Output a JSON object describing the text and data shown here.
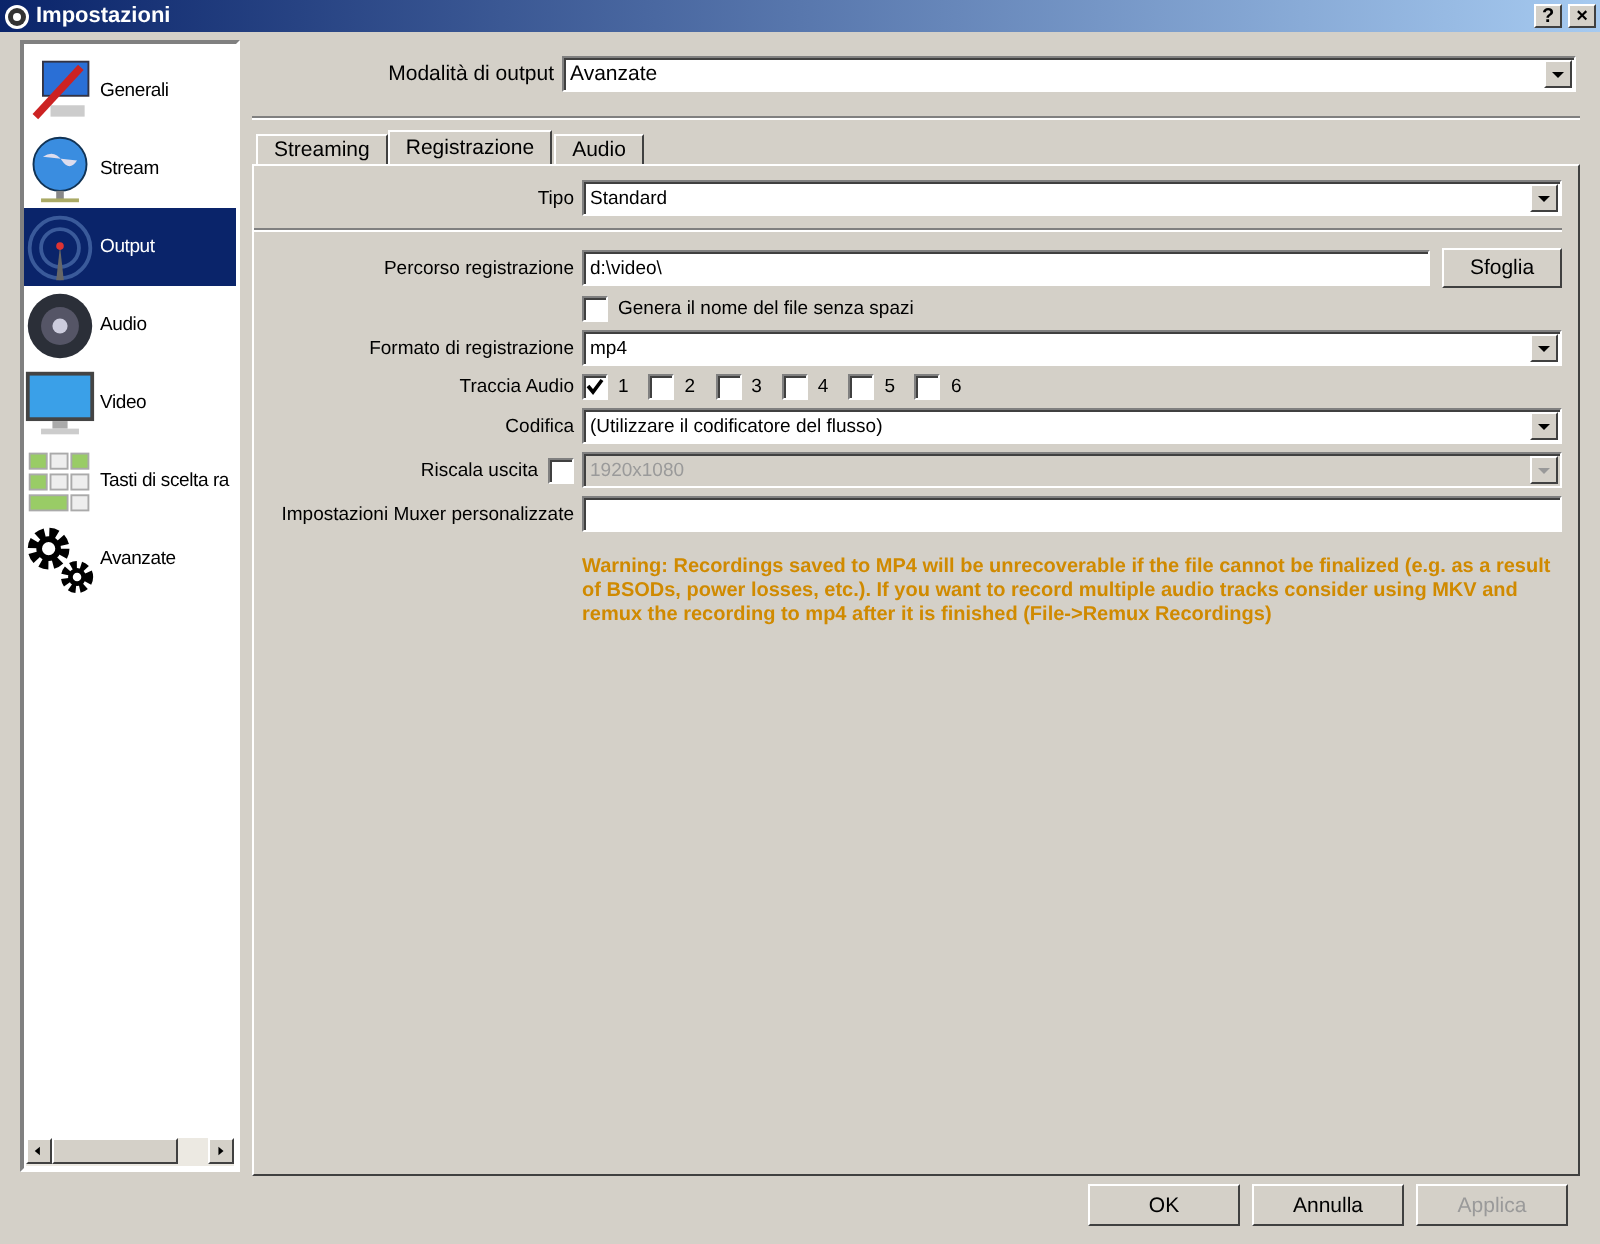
{
  "window": {
    "title": "Impostazioni",
    "buttons": [
      "?",
      "×"
    ]
  },
  "sidebar": {
    "items": [
      {
        "label": "Generali",
        "selected": false
      },
      {
        "label": "Stream",
        "selected": false
      },
      {
        "label": "Output",
        "selected": true
      },
      {
        "label": "Audio",
        "selected": false
      },
      {
        "label": "Video",
        "selected": false
      },
      {
        "label": "Tasti di scelta ra",
        "selected": false
      },
      {
        "label": "Avanzate",
        "selected": false
      }
    ]
  },
  "output_mode": {
    "label": "Modalità di output",
    "value": "Avanzate"
  },
  "tabs": [
    {
      "label": "Streaming",
      "selected": false
    },
    {
      "label": "Registrazione",
      "selected": true
    },
    {
      "label": "Audio",
      "selected": false
    }
  ],
  "form": {
    "rows": [
      {
        "kind": "combo",
        "label": "Tipo",
        "value": "Standard",
        "disabled": false
      },
      {
        "kind": "separator"
      },
      {
        "kind": "path",
        "label": "Percorso registrazione",
        "value": "d:\\video\\",
        "button": "Sfoglia"
      },
      {
        "kind": "checkbox",
        "label": "Genera il nome del file senza spazi",
        "checked": false
      },
      {
        "kind": "combo",
        "label": "Formato di registrazione",
        "value": "mp4",
        "disabled": false
      },
      {
        "kind": "tracks",
        "label": "Traccia Audio",
        "tracks": [
          {
            "label": "1",
            "checked": true
          },
          {
            "label": "2",
            "checked": false
          },
          {
            "label": "3",
            "checked": false
          },
          {
            "label": "4",
            "checked": false
          },
          {
            "label": "5",
            "checked": false
          },
          {
            "label": "6",
            "checked": false
          }
        ]
      },
      {
        "kind": "combo",
        "label": "Codifica",
        "value": "(Utilizzare il codificatore del flusso)",
        "disabled": false
      },
      {
        "kind": "rescale",
        "label": "Riscala uscita",
        "checked": false,
        "value": "1920x1080",
        "disabled": true
      },
      {
        "kind": "text",
        "label": "Impostazioni Muxer personalizzate"
      },
      {
        "kind": "warning",
        "text": "Warning: Recordings saved to MP4 will be unrecoverable if the file cannot be finalized (e.g. as a result of BSODs, power losses, etc.). If you want to record multiple audio tracks consider using MKV and remux the recording to mp4 after it is finished (File->Remux Recordings)"
      }
    ]
  },
  "footer": {
    "buttons": [
      {
        "label": "OK",
        "disabled": false
      },
      {
        "label": "Annulla",
        "disabled": false
      },
      {
        "label": "Applica",
        "disabled": true
      }
    ]
  }
}
